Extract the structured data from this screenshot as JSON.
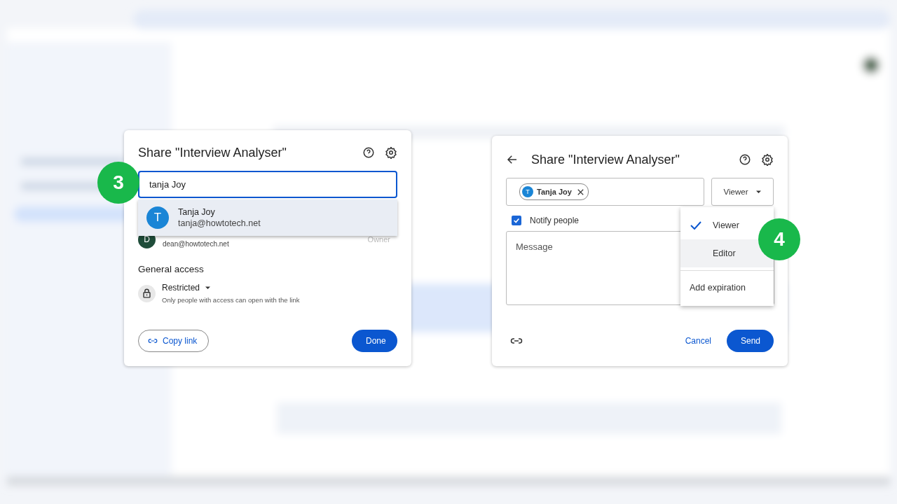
{
  "share_search_dialog": {
    "step": "3",
    "title": "Share \"Interview Analyser\"",
    "search": {
      "value": "tanja Joy"
    },
    "suggestion": {
      "initial": "T",
      "name": "Tanja Joy",
      "email": "tanja@howtotech.net"
    },
    "owner": {
      "initial": "D",
      "email": "dean@howtotech.net",
      "role": "Owner"
    },
    "general_access": {
      "heading": "General access",
      "setting": "Restricted",
      "description": "Only people with access can open with the link"
    },
    "copy_link": "Copy link",
    "done": "Done"
  },
  "share_invite_dialog": {
    "step": "4",
    "title": "Share \"Interview Analyser\"",
    "chip": {
      "initial": "T",
      "name": "Tanja Joy"
    },
    "role": "Viewer",
    "notify": {
      "label": "Notify people",
      "checked": true
    },
    "message": {
      "placeholder": "Message"
    },
    "menu": {
      "items": [
        {
          "label": "Viewer",
          "selected": true,
          "highlighted": false
        },
        {
          "label": "Editor",
          "selected": false,
          "highlighted": true
        }
      ],
      "extra": "Add expiration"
    },
    "cancel": "Cancel",
    "send": "Send"
  }
}
